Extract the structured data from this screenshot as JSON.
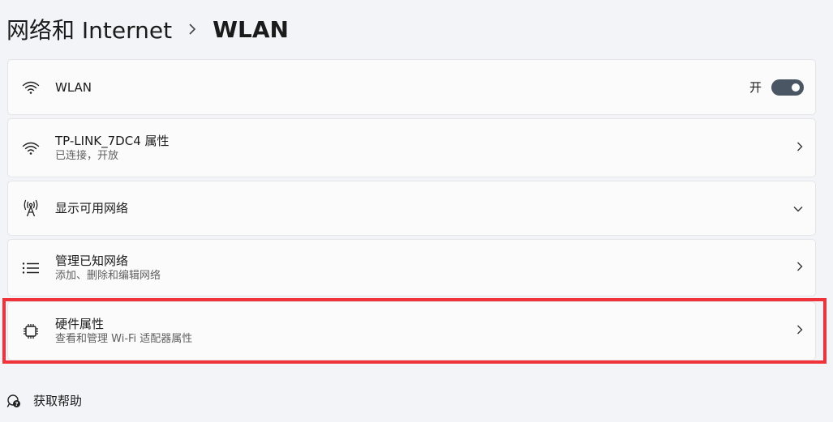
{
  "header": {
    "parent": "网络和 Internet",
    "current": "WLAN"
  },
  "wlan_toggle": {
    "title": "WLAN",
    "state_label": "开",
    "on": true
  },
  "network": {
    "title": "TP-LINK_7DC4 属性",
    "subtitle": "已连接，开放"
  },
  "available_networks": {
    "title": "显示可用网络"
  },
  "known_networks": {
    "title": "管理已知网络",
    "subtitle": "添加、删除和编辑网络"
  },
  "hardware": {
    "title": "硬件属性",
    "subtitle": "查看和管理 Wi-Fi 适配器属性"
  },
  "help": {
    "label": "获取帮助"
  },
  "colors": {
    "highlight": "#f0333b",
    "toggle_on": "#4a5663"
  },
  "icons": {
    "wlan": "wifi-icon",
    "network": "wifi-icon",
    "available": "antenna-icon",
    "known": "list-icon",
    "hardware": "chip-icon",
    "help": "help-icon"
  }
}
